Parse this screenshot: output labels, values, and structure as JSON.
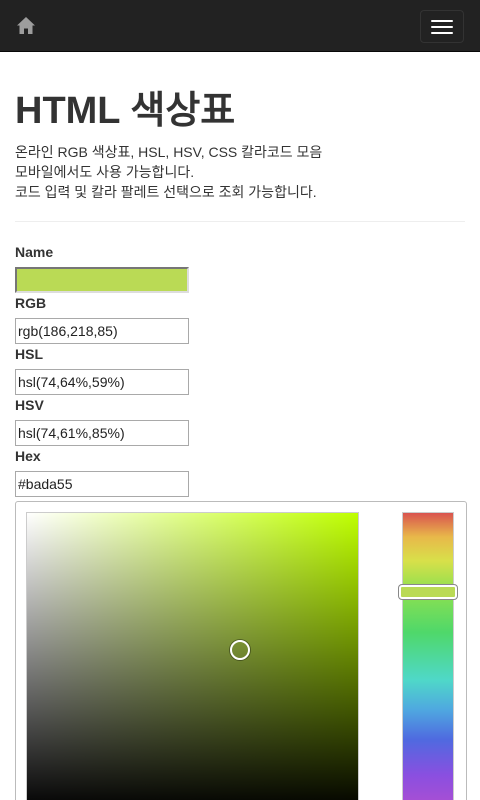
{
  "nav": {
    "home_icon": "home-icon",
    "menu_icon": "hamburger-menu-icon"
  },
  "page": {
    "title": "HTML 색상표",
    "description_lines": [
      "온라인 RGB 색상표, HSL, HSV, CSS 칼라코드 모음",
      "모바일에서도 사용 가능합니다.",
      "코드 입력 및 칼라 팔레트 선택으로 조회 가능합니다."
    ]
  },
  "fields": {
    "name": {
      "label": "Name",
      "swatch_color": "#bada55"
    },
    "rgb": {
      "label": "RGB",
      "value": "rgb(186,218,85)"
    },
    "hsl": {
      "label": "HSL",
      "value": "hsl(74,64%,59%)"
    },
    "hsv": {
      "label": "HSV",
      "value": "hsl(74,61%,85%)"
    },
    "hex": {
      "label": "Hex",
      "value": "#bada55"
    }
  },
  "picker": {
    "hue_color": "#bfff00",
    "selected_color": "#bada55",
    "saturation": 0.64,
    "value": 0.57,
    "hue_position": 0.27
  }
}
